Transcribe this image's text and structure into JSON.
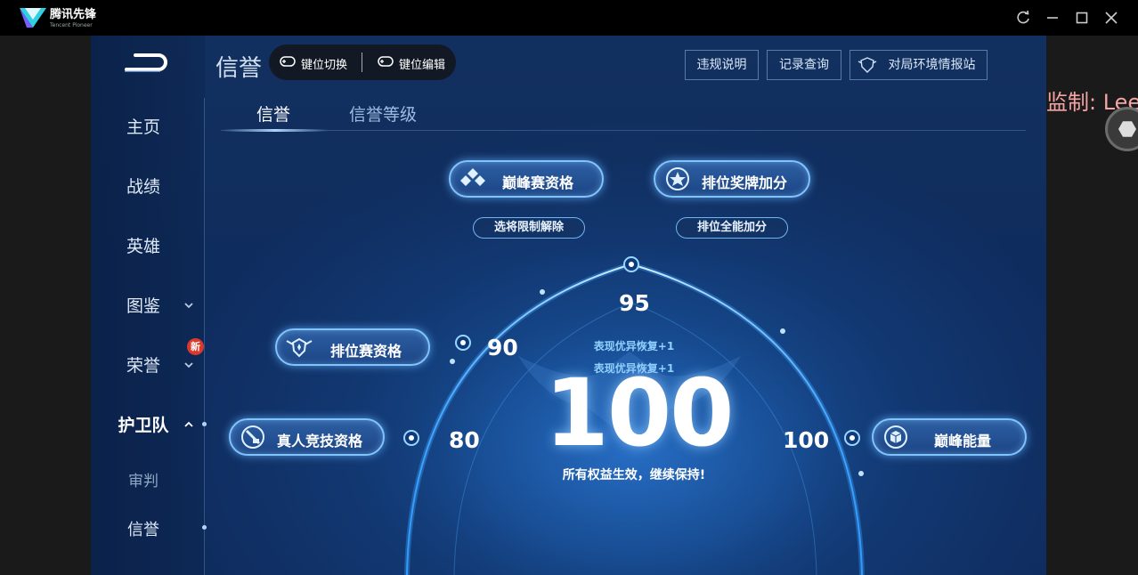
{
  "window": {
    "app_title": "腾讯先锋",
    "app_subtitle": "Tencent Pioneer",
    "watermark": "监制: Lee"
  },
  "nav": {
    "items": [
      {
        "label": "主页"
      },
      {
        "label": "战绩"
      },
      {
        "label": "英雄"
      },
      {
        "label": "图鉴"
      },
      {
        "label": "荣誉",
        "badge": "新"
      },
      {
        "label": "护卫队"
      },
      {
        "label": "审判"
      },
      {
        "label": "信誉"
      }
    ]
  },
  "header": {
    "title": "信誉",
    "key_switch": "键位切换",
    "key_edit": "键位编辑",
    "buttons": [
      "违规说明",
      "记录查询",
      "对局环境情报站"
    ]
  },
  "tabs": [
    "信誉",
    "信誉等级"
  ],
  "credit": {
    "score": "100",
    "recover_1": "表现优异恢复+1",
    "recover_2": "表现优异恢复+1",
    "status": "所有权益生效，继续保持!",
    "markers": [
      "80",
      "90",
      "95",
      "100"
    ],
    "perks": {
      "peak_qualify": "巅峰赛资格",
      "peak_qualify_sub": "选将限制解除",
      "rank_medal": "排位奖牌加分",
      "rank_medal_sub": "排位全能加分",
      "rank_qualify": "排位赛资格",
      "real_compete": "真人竞技资格",
      "peak_energy": "巅峰能量"
    }
  },
  "colors": {
    "accent": "#7fc3ff",
    "badge": "#d93a2b",
    "watermark": "#f4a4a4"
  }
}
